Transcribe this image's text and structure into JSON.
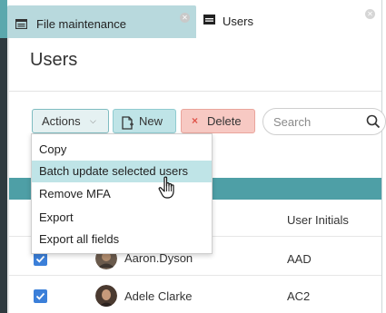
{
  "tabs": [
    {
      "label": "File maintenance",
      "active": false
    },
    {
      "label": "Users",
      "active": true
    }
  ],
  "page": {
    "title": "Users"
  },
  "toolbar": {
    "actions_label": "Actions",
    "new_label": "New",
    "delete_label": "Delete",
    "search_placeholder": "Search"
  },
  "actions_menu": [
    {
      "label": "Copy",
      "highlighted": false
    },
    {
      "label": "Batch update selected users",
      "highlighted": true
    },
    {
      "label": "Remove MFA",
      "highlighted": false
    },
    {
      "label": "Export",
      "highlighted": false
    },
    {
      "label": "Export all fields",
      "highlighted": false
    }
  ],
  "table": {
    "columns": [
      "User Initials"
    ],
    "rows": [
      {
        "checked": true,
        "name": "Aaron.Dyson",
        "initials": "AAD"
      },
      {
        "checked": true,
        "name": "Adele Clarke",
        "initials": "AC2"
      }
    ]
  },
  "colors": {
    "accent": "#4e9fa6",
    "new_button": "#bfe4e7",
    "delete_button": "#f7c9c3",
    "checkbox": "#3b7fd9",
    "menu_highlight": "#bfe4e7"
  }
}
